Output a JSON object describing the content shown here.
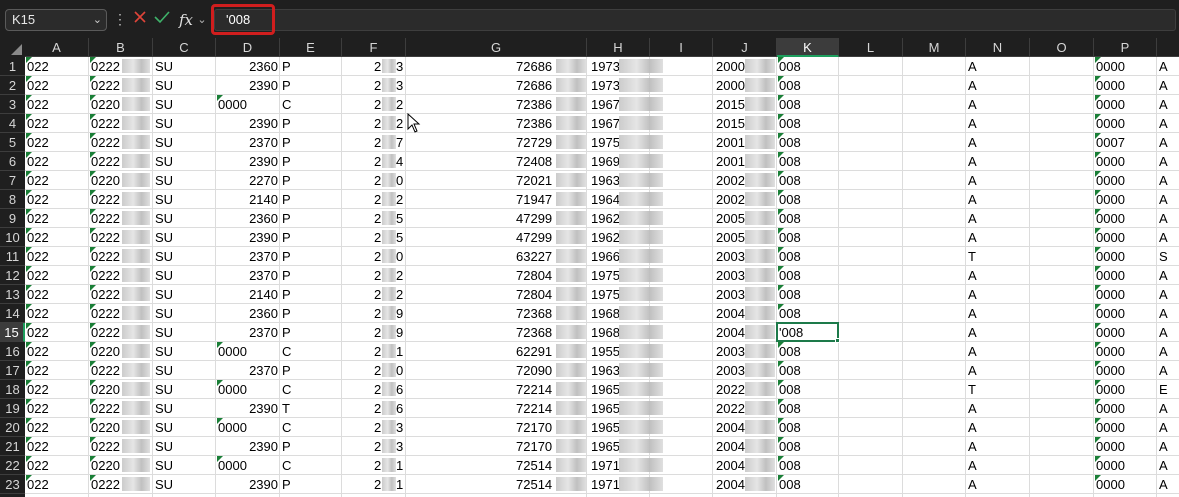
{
  "formula_bar": {
    "name_box": "K15",
    "formula": "'008"
  },
  "columns": [
    "A",
    "B",
    "C",
    "D",
    "E",
    "F",
    "G",
    "H",
    "I",
    "J",
    "K",
    "L",
    "M",
    "N",
    "O",
    "P",
    ""
  ],
  "selected_column": "K",
  "selected_row": "15",
  "rows": [
    {
      "n": "1",
      "A": "022",
      "B": "0222",
      "C": "SU",
      "D": "2360",
      "E": "P",
      "F1": "2",
      "F2": "3",
      "G": "72686",
      "H": "1973",
      "J": "2000",
      "K": "008",
      "N": "A",
      "P": "0000",
      "Q": "A"
    },
    {
      "n": "2",
      "A": "022",
      "B": "0222",
      "C": "SU",
      "D": "2390",
      "E": "P",
      "F1": "2",
      "F2": "3",
      "G": "72686",
      "H": "1973",
      "J": "2000",
      "K": "008",
      "N": "A",
      "P": "0000",
      "Q": "A"
    },
    {
      "n": "3",
      "A": "022",
      "B": "0220",
      "C": "SU",
      "D": "0000",
      "E": "C",
      "F1": "2",
      "F2": "2",
      "G": "72386",
      "H": "1967",
      "J": "2015",
      "K": "008",
      "N": "A",
      "P": "0000",
      "Q": "A"
    },
    {
      "n": "4",
      "A": "022",
      "B": "0222",
      "C": "SU",
      "D": "2390",
      "E": "P",
      "F1": "2",
      "F2": "2",
      "G": "72386",
      "H": "1967",
      "J": "2015",
      "K": "008",
      "N": "A",
      "P": "0000",
      "Q": "A"
    },
    {
      "n": "5",
      "A": "022",
      "B": "0222",
      "C": "SU",
      "D": "2370",
      "E": "P",
      "F1": "2",
      "F2": "7",
      "G": "72729",
      "H": "1975",
      "J": "2001",
      "K": "008",
      "N": "A",
      "P": "0007",
      "Q": "A"
    },
    {
      "n": "6",
      "A": "022",
      "B": "0222",
      "C": "SU",
      "D": "2390",
      "E": "P",
      "F1": "2",
      "F2": "4",
      "G": "72408",
      "H": "1969",
      "J": "2001",
      "K": "008",
      "N": "A",
      "P": "0000",
      "Q": "A"
    },
    {
      "n": "7",
      "A": "022",
      "B": "0220",
      "C": "SU",
      "D": "2270",
      "E": "P",
      "F1": "2",
      "F2": "0",
      "G": "72021",
      "H": "1963",
      "J": "2002",
      "K": "008",
      "N": "A",
      "P": "0000",
      "Q": "A"
    },
    {
      "n": "8",
      "A": "022",
      "B": "0222",
      "C": "SU",
      "D": "2140",
      "E": "P",
      "F1": "2",
      "F2": "2",
      "G": "71947",
      "H": "1964",
      "J": "2002",
      "K": "008",
      "N": "A",
      "P": "0000",
      "Q": "A"
    },
    {
      "n": "9",
      "A": "022",
      "B": "0222",
      "C": "SU",
      "D": "2360",
      "E": "P",
      "F1": "2",
      "F2": "5",
      "G": "47299",
      "H": "1962",
      "J": "2005",
      "K": "008",
      "N": "A",
      "P": "0000",
      "Q": "A"
    },
    {
      "n": "10",
      "A": "022",
      "B": "0222",
      "C": "SU",
      "D": "2390",
      "E": "P",
      "F1": "2",
      "F2": "5",
      "G": "47299",
      "H": "1962",
      "J": "2005",
      "K": "008",
      "N": "A",
      "P": "0000",
      "Q": "A"
    },
    {
      "n": "11",
      "A": "022",
      "B": "0222",
      "C": "SU",
      "D": "2370",
      "E": "P",
      "F1": "2",
      "F2": "0",
      "G": "63227",
      "H": "1966",
      "J": "2003",
      "K": "008",
      "N": "T",
      "P": "0000",
      "Q": "S"
    },
    {
      "n": "12",
      "A": "022",
      "B": "0222",
      "C": "SU",
      "D": "2370",
      "E": "P",
      "F1": "2",
      "F2": "2",
      "G": "72804",
      "H": "1975",
      "J": "2003",
      "K": "008",
      "N": "A",
      "P": "0000",
      "Q": "A"
    },
    {
      "n": "13",
      "A": "022",
      "B": "0222",
      "C": "SU",
      "D": "2140",
      "E": "P",
      "F1": "2",
      "F2": "2",
      "G": "72804",
      "H": "1975",
      "J": "2003",
      "K": "008",
      "N": "A",
      "P": "0000",
      "Q": "A"
    },
    {
      "n": "14",
      "A": "022",
      "B": "0222",
      "C": "SU",
      "D": "2360",
      "E": "P",
      "F1": "2",
      "F2": "9",
      "G": "72368",
      "H": "1968",
      "J": "2004",
      "K": "008",
      "N": "A",
      "P": "0000",
      "Q": "A"
    },
    {
      "n": "15",
      "A": "022",
      "B": "0222",
      "C": "SU",
      "D": "2370",
      "E": "P",
      "F1": "2",
      "F2": "9",
      "G": "72368",
      "H": "1968",
      "J": "2004",
      "K": "'008",
      "N": "A",
      "P": "0000",
      "Q": "A"
    },
    {
      "n": "16",
      "A": "022",
      "B": "0220",
      "C": "SU",
      "D": "0000",
      "E": "C",
      "F1": "2",
      "F2": "1",
      "G": "62291",
      "H": "1955",
      "J": "2003",
      "K": "008",
      "N": "A",
      "P": "0000",
      "Q": "A"
    },
    {
      "n": "17",
      "A": "022",
      "B": "0222",
      "C": "SU",
      "D": "2370",
      "E": "P",
      "F1": "2",
      "F2": "0",
      "G": "72090",
      "H": "1963",
      "J": "2003",
      "K": "008",
      "N": "A",
      "P": "0000",
      "Q": "A"
    },
    {
      "n": "18",
      "A": "022",
      "B": "0220",
      "C": "SU",
      "D": "0000",
      "E": "C",
      "F1": "2",
      "F2": "6",
      "G": "72214",
      "H": "1965",
      "J": "2022",
      "K": "008",
      "N": "T",
      "P": "0000",
      "Q": "E"
    },
    {
      "n": "19",
      "A": "022",
      "B": "0222",
      "C": "SU",
      "D": "2390",
      "E": "T",
      "F1": "2",
      "F2": "6",
      "G": "72214",
      "H": "1965",
      "J": "2022",
      "K": "008",
      "N": "A",
      "P": "0000",
      "Q": "A"
    },
    {
      "n": "20",
      "A": "022",
      "B": "0220",
      "C": "SU",
      "D": "0000",
      "E": "C",
      "F1": "2",
      "F2": "3",
      "G": "72170",
      "H": "1965",
      "J": "2004",
      "K": "008",
      "N": "A",
      "P": "0000",
      "Q": "A"
    },
    {
      "n": "21",
      "A": "022",
      "B": "0222",
      "C": "SU",
      "D": "2390",
      "E": "P",
      "F1": "2",
      "F2": "3",
      "G": "72170",
      "H": "1965",
      "J": "2004",
      "K": "008",
      "N": "A",
      "P": "0000",
      "Q": "A"
    },
    {
      "n": "22",
      "A": "022",
      "B": "0220",
      "C": "SU",
      "D": "0000",
      "E": "C",
      "F1": "2",
      "F2": "1",
      "G": "72514",
      "H": "1971",
      "J": "2004",
      "K": "008",
      "N": "A",
      "P": "0000",
      "Q": "A"
    },
    {
      "n": "23",
      "A": "022",
      "B": "0222",
      "C": "SU",
      "D": "2390",
      "E": "P",
      "F1": "2",
      "F2": "1",
      "G": "72514",
      "H": "1971",
      "J": "2004",
      "K": "008",
      "N": "A",
      "P": "0000",
      "Q": "A"
    }
  ]
}
